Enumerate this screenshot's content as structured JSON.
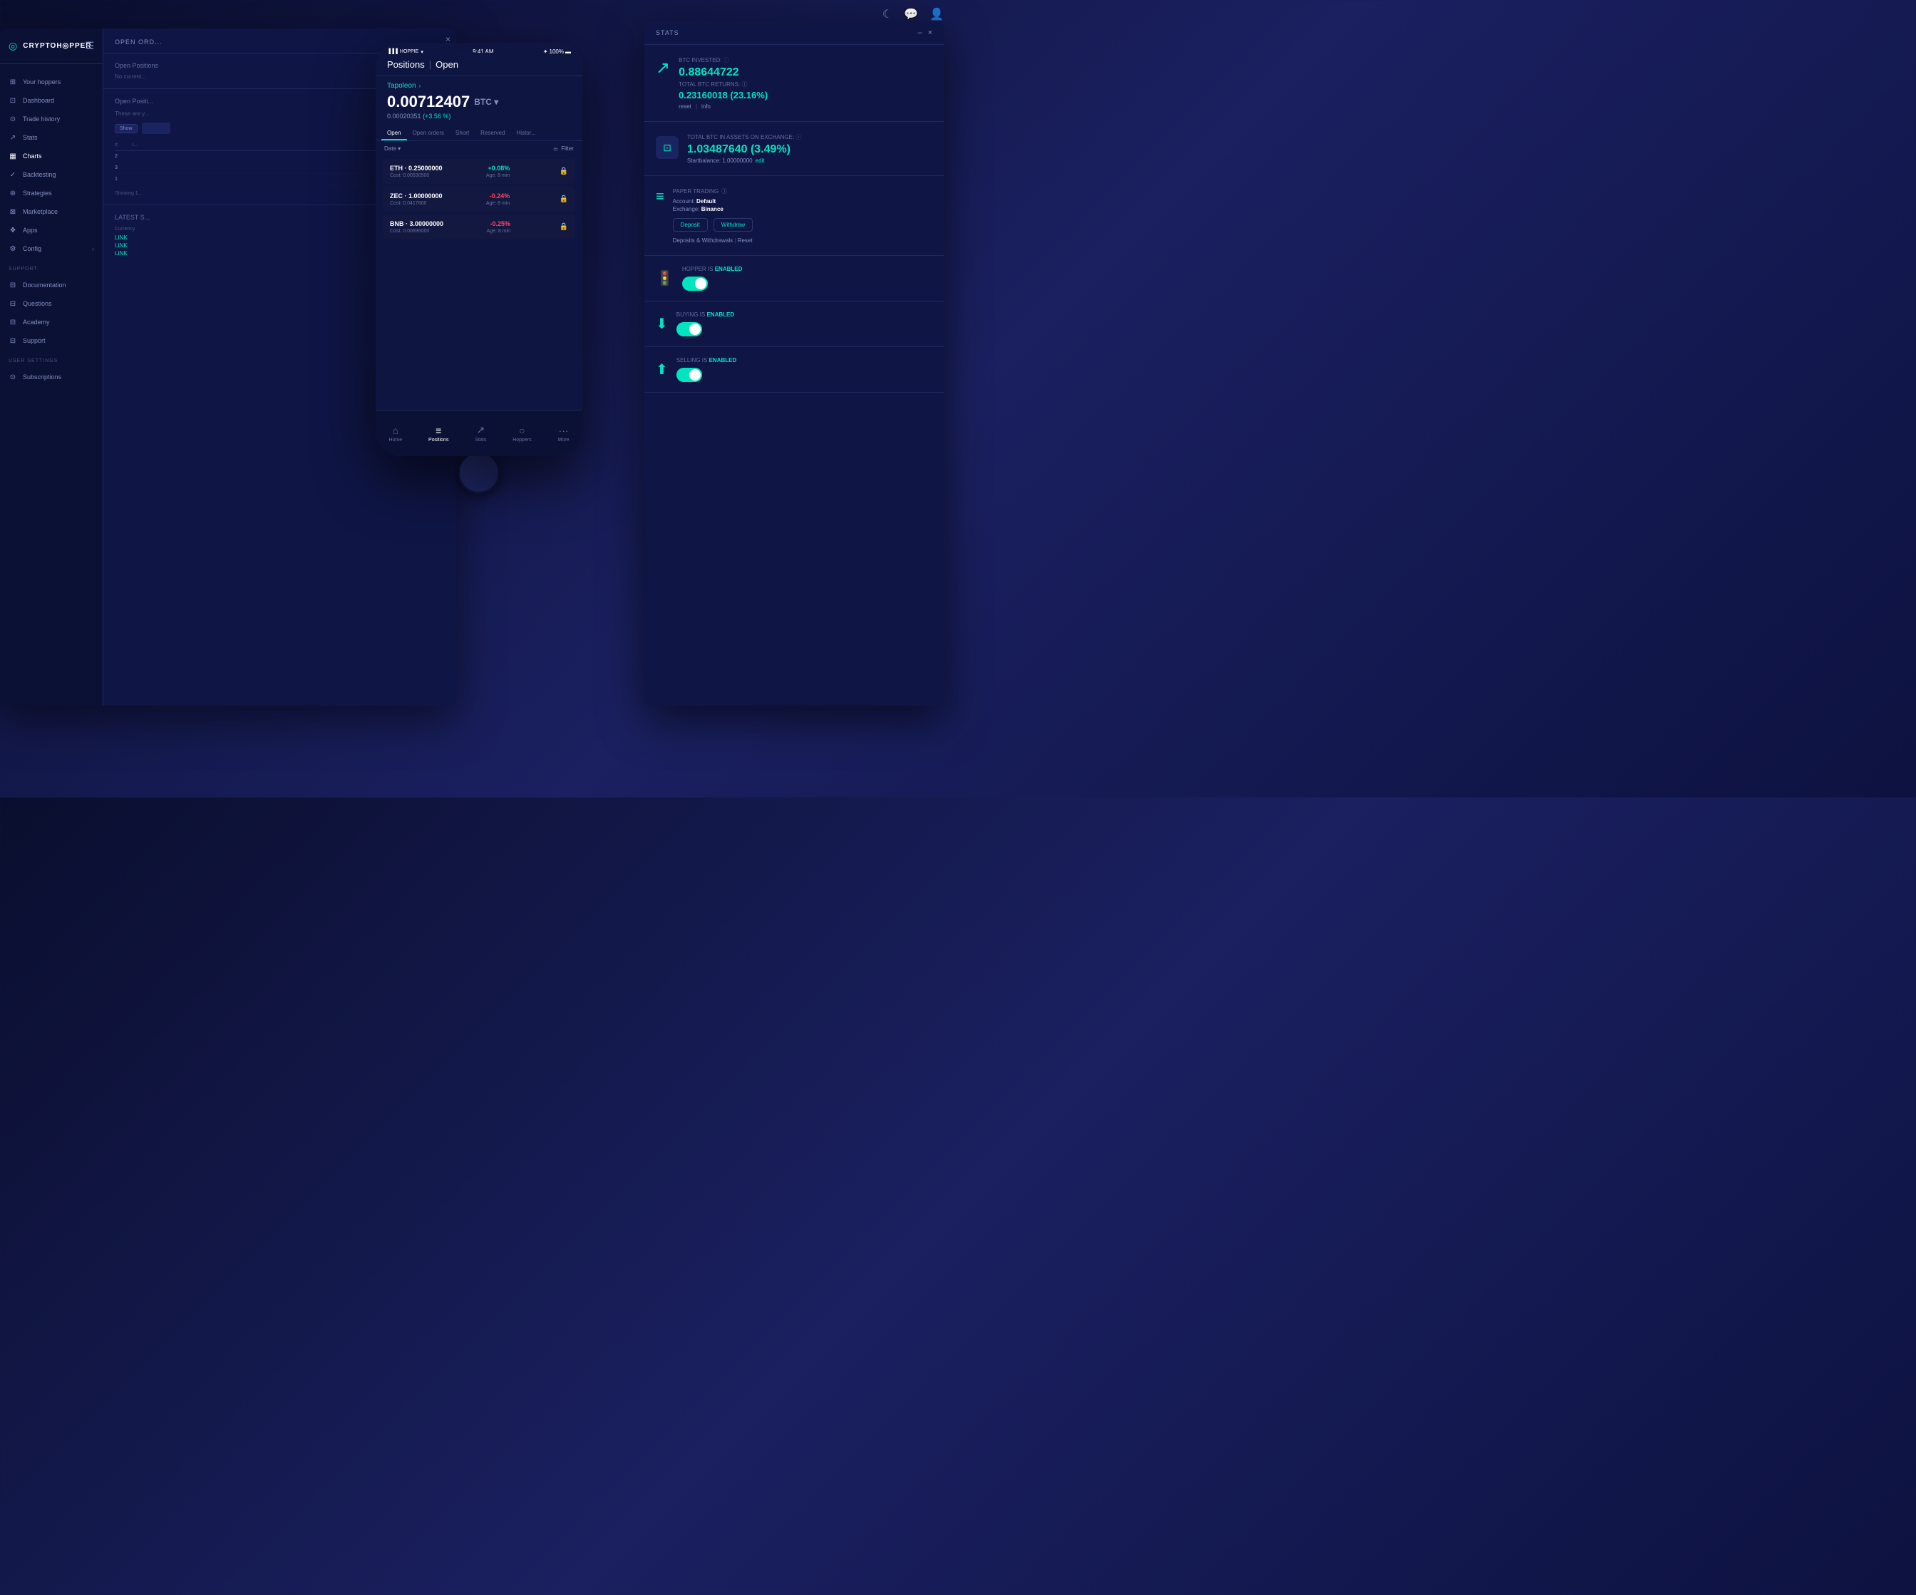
{
  "app": {
    "title": "CryptoHopper",
    "logo": "CRYPTOH◎PPER"
  },
  "topbar": {
    "moon_icon": "☾",
    "chat_icon": "💬",
    "user_icon": "👤"
  },
  "sidebar": {
    "items": [
      {
        "id": "your-hoppers",
        "label": "Your hoppers",
        "icon": "⊞"
      },
      {
        "id": "dashboard",
        "label": "Dashboard",
        "icon": "⊡"
      },
      {
        "id": "trade-history",
        "label": "Trade history",
        "icon": "⊙"
      },
      {
        "id": "stats",
        "label": "Stats",
        "icon": "↗"
      },
      {
        "id": "charts",
        "label": "Charts",
        "icon": "▦"
      },
      {
        "id": "backtesting",
        "label": "Backtesting",
        "icon": "✓"
      },
      {
        "id": "strategies",
        "label": "Strategies",
        "icon": "⊛"
      },
      {
        "id": "marketplace",
        "label": "Marketplace",
        "icon": "⊠"
      },
      {
        "id": "apps",
        "label": "Apps",
        "icon": "❖"
      },
      {
        "id": "config",
        "label": "Config",
        "icon": "⚙"
      }
    ],
    "support_section": "SUPPORT",
    "support_items": [
      {
        "id": "documentation",
        "label": "Documentation",
        "icon": "⊟"
      },
      {
        "id": "questions",
        "label": "Questions",
        "icon": "⊟"
      },
      {
        "id": "academy",
        "label": "Academy",
        "icon": "⊟"
      },
      {
        "id": "support",
        "label": "Support",
        "icon": "⊟"
      }
    ],
    "user_settings_section": "USER SETTINGS",
    "user_items": [
      {
        "id": "subscriptions",
        "label": "Subscriptions",
        "icon": "⊙"
      }
    ]
  },
  "main": {
    "header": "OPEN ORD...",
    "open_orders_title": "Open Positions",
    "no_current_text": "No current...",
    "open_positions_label": "Open Positi...",
    "positions_note": "These are y...",
    "show_btn_label": "Show",
    "table_headers": [
      "#",
      "I...",
      "",
      "",
      ""
    ],
    "table_rows": [
      {
        "num": "2",
        "col2": "",
        "col3": "",
        "col4": "",
        "col5": ""
      },
      {
        "num": "3",
        "col2": "",
        "col3": "",
        "col4": "",
        "col5": ""
      },
      {
        "num": "1",
        "col2": "",
        "col3": "",
        "col4": "",
        "col5": ""
      }
    ],
    "showing_text": "Showing 1...",
    "latest_section": "LATEST S...",
    "currency_label": "Currency",
    "links": [
      "LINK",
      "LINK",
      "LINK"
    ]
  },
  "stats_panel": {
    "title": "STATS",
    "window_min": "–",
    "window_close": "×",
    "btc_invested_label": "BTC INVESTED:",
    "btc_invested_value": "0.88644722",
    "btc_returns_label": "TOTAL BTC RETURNS:",
    "btc_returns_value": "0.23160018 (23.16%)",
    "reset_link": "reset",
    "info_link": "info",
    "total_btc_label": "TOTAL BTC IN ASSETS ON EXCHANGE:",
    "total_btc_value": "1.03487640 (3.49%)",
    "startbalance": "Startbalance: 1.00000000",
    "edit_link": "edit",
    "paper_trading_label": "PAPER TRADING",
    "account_label": "Account:",
    "account_value": "Default",
    "exchange_label": "Exchange:",
    "exchange_value": "Binance",
    "deposit_btn": "Deposit",
    "withdraw_btn": "Withdraw",
    "deposits_withdrawals": "Deposits & Withdrawals",
    "reset_link2": "Reset",
    "hopper_enabled_label": "HOPPER IS",
    "hopper_enabled_status": "ENABLED",
    "buying_enabled_label": "BUYING IS",
    "buying_enabled_status": "ENABLED",
    "selling_enabled_label": "SELLING IS",
    "selling_enabled_status": "ENABLED"
  },
  "phone": {
    "carrier": "HOPPIE",
    "time": "9:41 AM",
    "battery": "100%",
    "title": "Positions",
    "title_separator": "|",
    "title_sub": "Open",
    "hopper_name": "Tapoleon",
    "btc_amount": "0.00712407",
    "btc_currency": "BTC",
    "btc_cost": "0.00020351",
    "btc_change_pct": "(+3.56 %)",
    "tabs": [
      "Open",
      "Open orders",
      "Short",
      "Reserved",
      "Histor..."
    ],
    "date_filter": "Date ▾",
    "filter_label": "Filter",
    "positions": [
      {
        "coin": "ETH",
        "amount": "0.25000000",
        "cost": "Cost: 0.00530500",
        "change": "+0.08%",
        "change_type": "positive",
        "age": "Age: 8 min"
      },
      {
        "coin": "ZEC",
        "amount": "1.00000000",
        "cost": "Cost: 0.0417800",
        "change": "-0.24%",
        "change_type": "negative",
        "age": "Age: 8 min"
      },
      {
        "coin": "BNB",
        "amount": "3.00000000",
        "cost": "Cost: 0.00696000",
        "change": "-0.25%",
        "change_type": "negative",
        "age": "Age: 8 min"
      }
    ],
    "bottom_nav": [
      {
        "id": "home",
        "label": "Home",
        "icon": "⌂",
        "active": false
      },
      {
        "id": "positions",
        "label": "Positions",
        "icon": "≡",
        "active": true
      },
      {
        "id": "stats",
        "label": "Stats",
        "icon": "↗",
        "active": false
      },
      {
        "id": "hoppers",
        "label": "Hoppers",
        "icon": "○",
        "active": false
      },
      {
        "id": "more",
        "label": "More",
        "icon": "···",
        "active": false
      }
    ]
  },
  "colors": {
    "accent": "#00e5c0",
    "bg_dark": "#0b1035",
    "bg_mid": "#0f1545",
    "text_muted": "#6070a0",
    "text_light": "#8090c0",
    "negative": "#ff4466"
  }
}
